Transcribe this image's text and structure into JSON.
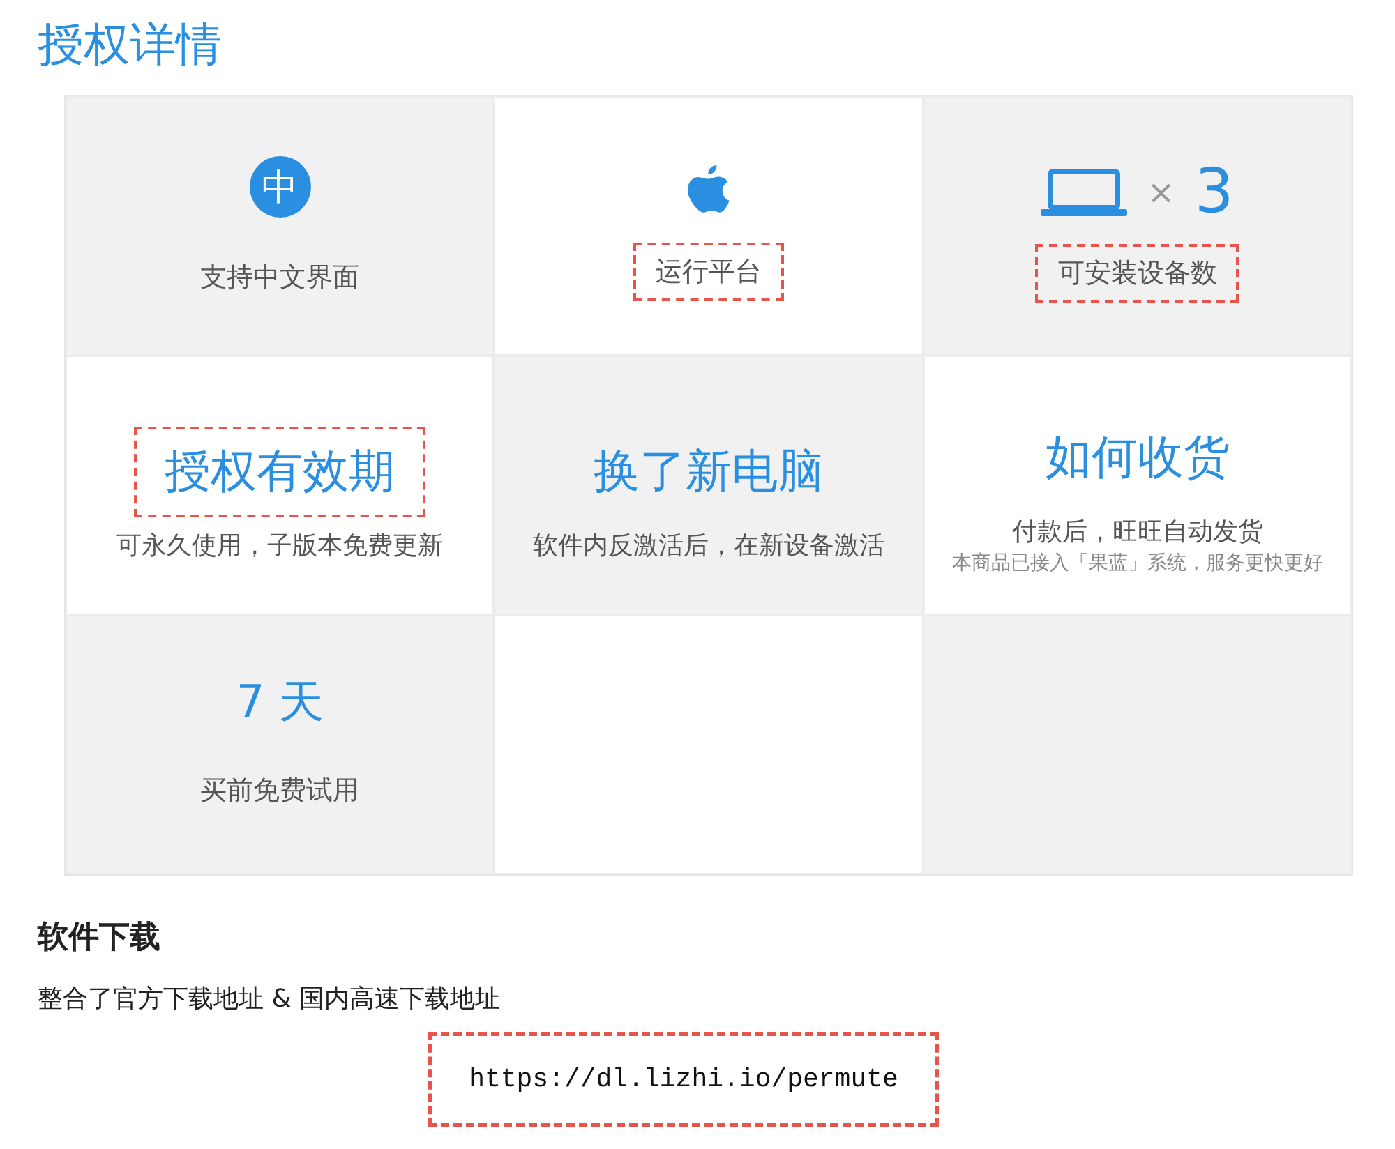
{
  "title": "授权详情",
  "cells": [
    {
      "kind": "badge",
      "shaded": true,
      "badge": "中",
      "label": "支持中文界面",
      "highlighted": false
    },
    {
      "kind": "platform",
      "shaded": false,
      "label": "运行平台",
      "highlighted": true
    },
    {
      "kind": "devices",
      "shaded": true,
      "times": "×",
      "count": "3",
      "label": "可安装设备数",
      "highlighted": true
    },
    {
      "kind": "headline",
      "shaded": false,
      "title": "授权有效期",
      "subtitle": "可永久使用，子版本免费更新",
      "highlighted": true
    },
    {
      "kind": "headline",
      "shaded": true,
      "title": "换了新电脑",
      "subtitle": "软件内反激活后，在新设备激活",
      "highlighted": false
    },
    {
      "kind": "headline",
      "shaded": false,
      "title": "如何收货",
      "subtitle": "付款后，旺旺自动发货",
      "note": "本商品已接入「果蓝」系统，服务更快更好",
      "highlighted": false
    },
    {
      "kind": "trial",
      "shaded": true,
      "title": "7 天",
      "subtitle": "买前免费试用",
      "highlighted": false
    },
    {
      "kind": "empty",
      "shaded": false
    },
    {
      "kind": "empty",
      "shaded": true
    }
  ],
  "download": {
    "heading": "软件下载",
    "description": "整合了官方下载地址 & 国内高速下载地址",
    "url": "https://dl.lizhi.io/permute",
    "highlighted": true
  }
}
